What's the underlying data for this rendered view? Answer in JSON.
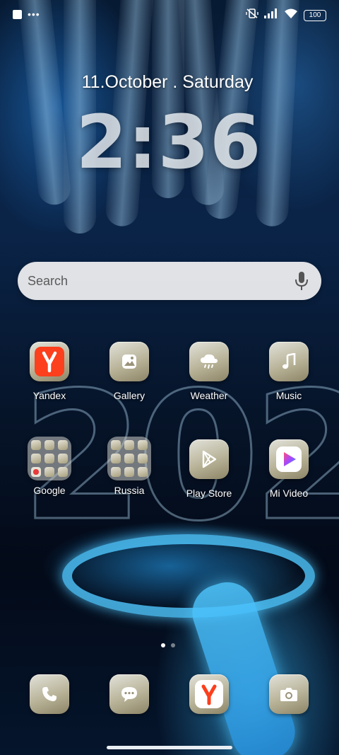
{
  "status_bar": {
    "left_icons": [
      "notification-square-icon",
      "more-dots-icon"
    ],
    "more_dots": "•••",
    "right_icons": [
      "mute-vibrate-icon",
      "signal-bars-icon",
      "wifi-icon",
      "battery-icon"
    ],
    "battery_level": "100"
  },
  "lockscreen": {
    "date": "11.October . Saturday",
    "time": "2:36"
  },
  "search": {
    "placeholder": "Search",
    "mic_icon": "microphone-icon"
  },
  "wallpaper": {
    "accent_color": "#4fc3ff",
    "background_color": "#071a33"
  },
  "home_grid": {
    "row1": [
      {
        "label": "Yandex",
        "icon": "yandex-icon",
        "icon_color": "#fc3f1d"
      },
      {
        "label": "Gallery",
        "icon": "gallery-icon"
      },
      {
        "label": "Weather",
        "icon": "weather-icon"
      },
      {
        "label": "Music",
        "icon": "music-note-icon"
      }
    ],
    "row2": [
      {
        "label": "Google",
        "icon": "folder-icon"
      },
      {
        "label": "Russia",
        "icon": "folder-icon"
      },
      {
        "label": "Play Store",
        "icon": "play-store-icon"
      },
      {
        "label": "Mi Video",
        "icon": "mi-video-icon"
      }
    ]
  },
  "page_indicator": {
    "pages": 2,
    "active": 1
  },
  "dock": [
    {
      "name": "phone",
      "icon": "phone-icon"
    },
    {
      "name": "messages",
      "icon": "message-icon"
    },
    {
      "name": "yandex-browser",
      "icon": "yandex-icon",
      "icon_color": "#fc3f1d"
    },
    {
      "name": "camera",
      "icon": "camera-icon"
    }
  ]
}
